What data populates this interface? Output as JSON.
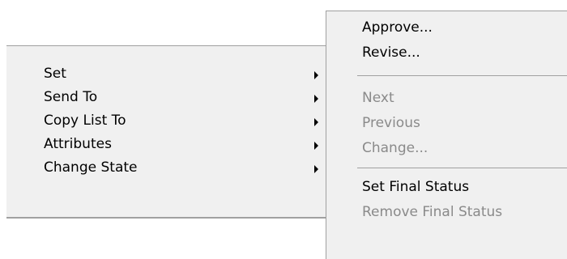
{
  "main_menu": {
    "items": [
      {
        "label": "Set",
        "has_submenu": true
      },
      {
        "label": "Send To",
        "has_submenu": true
      },
      {
        "label": "Copy List To",
        "has_submenu": true
      },
      {
        "label": "Attributes",
        "has_submenu": true
      },
      {
        "label": "Change State",
        "has_submenu": true
      }
    ]
  },
  "submenu": {
    "group1": [
      {
        "label": "Approve...",
        "enabled": true
      },
      {
        "label": "Revise...",
        "enabled": true
      }
    ],
    "group2": [
      {
        "label": "Next",
        "enabled": false
      },
      {
        "label": "Previous",
        "enabled": false
      },
      {
        "label": "Change...",
        "enabled": false
      }
    ],
    "group3": [
      {
        "label": "Set Final Status",
        "enabled": true
      },
      {
        "label": "Remove Final Status",
        "enabled": false
      }
    ]
  },
  "colors": {
    "menu_background": "#f0f0f0",
    "disabled_text": "#8a8a8a",
    "separator": "#a0a0a0"
  }
}
